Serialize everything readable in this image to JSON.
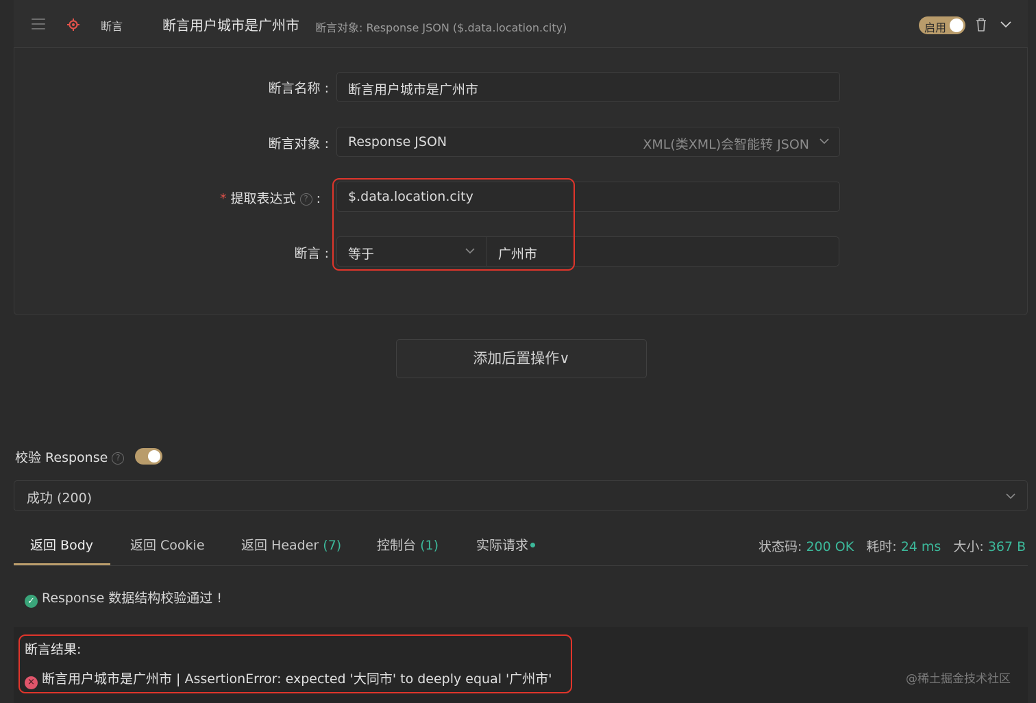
{
  "header": {
    "type_label": "断言",
    "title": "断言用户城市是广州市",
    "subtitle": "断言对象: Response JSON ($.data.location.city)",
    "enable_label": "启用"
  },
  "form": {
    "name_label": "断言名称 :",
    "name_value": "断言用户城市是广州市",
    "target_label": "断言对象 :",
    "target_value": "Response JSON",
    "target_hint": "XML(类XML)会智能转 JSON",
    "expr_star": "*",
    "expr_label": "提取表达式",
    "expr_help": "?",
    "expr_colon": ":",
    "expr_value": "$.data.location.city",
    "assert_label": "断言 :",
    "operator_value": "等于",
    "expected_value": "广州市"
  },
  "add_post_op": "添加后置操作∨",
  "verify": {
    "label": "校验 Response",
    "help": "?",
    "status_selected": "成功 (200)"
  },
  "tabs": [
    {
      "label": "返回 Body",
      "count": ""
    },
    {
      "label": "返回 Cookie",
      "count": ""
    },
    {
      "label": "返回 Header",
      "count": "(7)"
    },
    {
      "label": "控制台",
      "count": "(1)"
    },
    {
      "label": "实际请求",
      "count": ""
    }
  ],
  "stats": {
    "status_label": "状态码:",
    "status_value": "200 OK",
    "time_label": "耗时:",
    "time_value": "24 ms",
    "size_label": "大小:",
    "size_value": "367 B"
  },
  "validation_message": "Response 数据结构校验通过 !",
  "result": {
    "title": "断言结果:",
    "error_text": "断言用户城市是广州市 | AssertionError: expected '大同市' to deeply equal '广州市'"
  },
  "watermark": "@稀土掘金技术社区",
  "colors": {
    "accent": "#b99c6b",
    "success": "#3cb89a",
    "error": "#e0352b"
  }
}
